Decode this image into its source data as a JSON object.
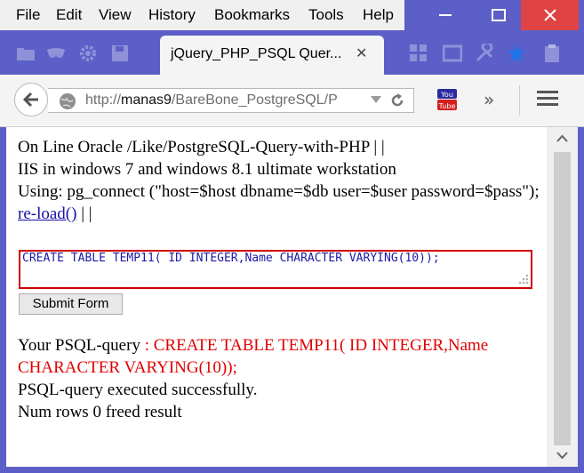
{
  "menu": [
    "File",
    "Edit",
    "View",
    "History",
    "Bookmarks",
    "Tools",
    "Help"
  ],
  "tab": {
    "title": "jQuery_PHP_PSQL Quer...",
    "close": "✕"
  },
  "nav": {
    "url_prefix": "http://",
    "url_host": "manas9",
    "url_path": "/BareBone_PostgreSQL/P",
    "more": "»"
  },
  "page": {
    "line1": "On Line Oracle /Like/PostgreSQL-Query-with-PHP | |",
    "line2": "IIS in windows 7 and windows 8.1 ultimate workstation",
    "line3": "Using: pg_connect (\"host=$host dbname=$db user=$user password=$pass\");",
    "reload_link": "re-load()",
    "reload_sep": " | |",
    "sql_input": "CREATE TABLE TEMP11( ID INTEGER,Name CHARACTER VARYING(10));",
    "submit_label": "Submit Form",
    "query_label": "Your PSQL-query",
    "query_value": ": CREATE TABLE TEMP11( ID INTEGER,Name CHARACTER VARYING(10));",
    "status": "PSQL-query executed successfully.",
    "rows": "Num rows 0 freed result"
  },
  "colors": {
    "window_frame": "#5b5fc7",
    "close_button": "#e04343",
    "sql_border": "#d00000",
    "query_text": "#e00000",
    "link": "#1a0dab"
  }
}
